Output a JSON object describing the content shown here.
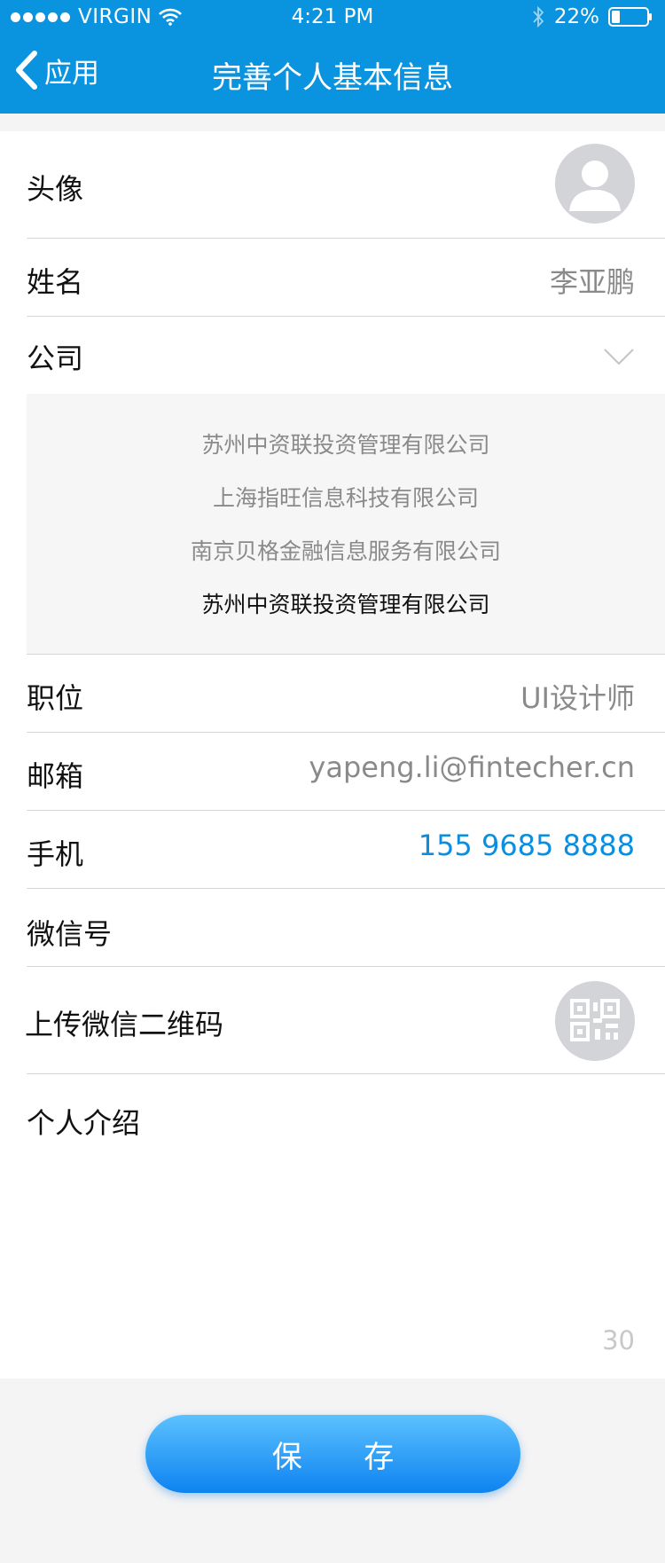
{
  "status_bar": {
    "carrier": "VIRGIN",
    "time": "4:21 PM",
    "battery": "22%"
  },
  "nav": {
    "back_label": "应用",
    "title": "完善个人基本信息"
  },
  "form": {
    "avatar_label": "头像",
    "name_label": "姓名",
    "name_value": "李亚鹏",
    "company_label": "公司",
    "company_options": [
      "苏州中资联投资管理有限公司",
      "上海指旺信息科技有限公司",
      "南京贝格金融信息服务有限公司",
      "苏州中资联投资管理有限公司"
    ],
    "company_selected_index": 3,
    "position_label": "职位",
    "position_value": "UI设计师",
    "email_label": "邮箱",
    "email_value": "yapeng.li@fintecher.cn",
    "phone_label": "手机",
    "phone_value": "155 9685 8888",
    "wechat_label": "微信号",
    "wechat_value": "",
    "qr_label": "上传微信二维码",
    "intro_label": "个人介绍",
    "intro_counter": "30"
  },
  "save_label": "保 存",
  "colors": {
    "header_bg": "#0a93df",
    "accent": "#0a8ee0",
    "muted": "#8a8a8a"
  }
}
